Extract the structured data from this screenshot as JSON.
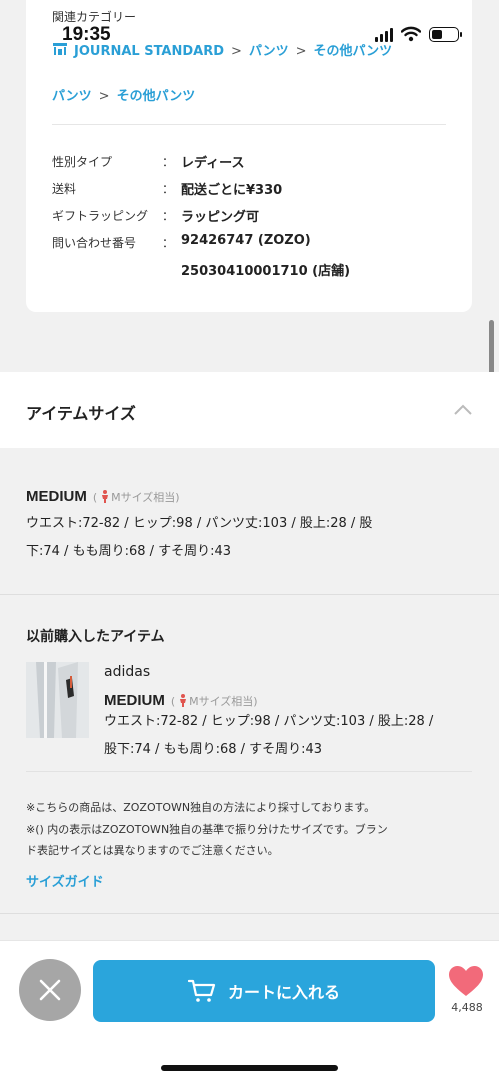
{
  "status_bar": {
    "time": "19:35"
  },
  "details": {
    "category_label": "関連カテゴリー",
    "breadcrumb1": [
      "JOURNAL STANDARD",
      "パンツ",
      "その他パンツ"
    ],
    "breadcrumb_sep": ">",
    "breadcrumb2": [
      "パンツ",
      "その他パンツ"
    ],
    "rows": [
      {
        "label": "性別タイプ",
        "colon": "：",
        "value": "レディース"
      },
      {
        "label": "送料",
        "colon": "：",
        "value": "配送ごとに¥330"
      },
      {
        "label": "ギフトラッピング",
        "colon": "：",
        "value": "ラッピング可"
      },
      {
        "label": "問い合わせ番号",
        "colon": "：",
        "value": "92426747 (ZOZO)",
        "value2": "25030410001710 (店舗)"
      }
    ]
  },
  "item_size": {
    "title": "アイテムサイズ",
    "current": {
      "size": "MEDIUM",
      "equiv_open": "(",
      "equiv": "Mサイズ相当)",
      "measure_line1": "ウエスト:72-82 / ヒップ:98 / パンツ丈:103 / 股上:28 / 股",
      "measure_line2": "下:74 / もも周り:68 / すそ周り:43"
    },
    "previous_title": "以前購入したアイテム",
    "previous": {
      "brand": "adidas",
      "size": "MEDIUM",
      "equiv_open": "(",
      "equiv": "Mサイズ相当)",
      "measure_line1": "ウエスト:72-82 / ヒップ:98 / パンツ丈:103 / 股上:28 /",
      "measure_line2": "股下:74 / もも周り:68 / すそ周り:43"
    },
    "note1": "※こちらの商品は、ZOZOTOWN独自の方法により採寸しております。",
    "note2a": "※() 内の表示はZOZOTOWN独自の基準で振り分けたサイズです。ブラン",
    "note2b": "ド表記サイズとは異なりますのでご注意ください。",
    "size_guide": "サイズガイド"
  },
  "bottom_bar": {
    "cart_label": "カートに入れる",
    "favorite_count": "4,488"
  },
  "colors": {
    "accent": "#2aa5dc",
    "link": "#2a9fd6",
    "heart": "#f26a7a",
    "person_icon": "#e0554f"
  },
  "icons": [
    "shop-icon",
    "chevron-up-icon",
    "person-icon",
    "close-icon",
    "cart-icon",
    "heart-icon",
    "signal-icon",
    "wifi-icon",
    "battery-icon"
  ]
}
